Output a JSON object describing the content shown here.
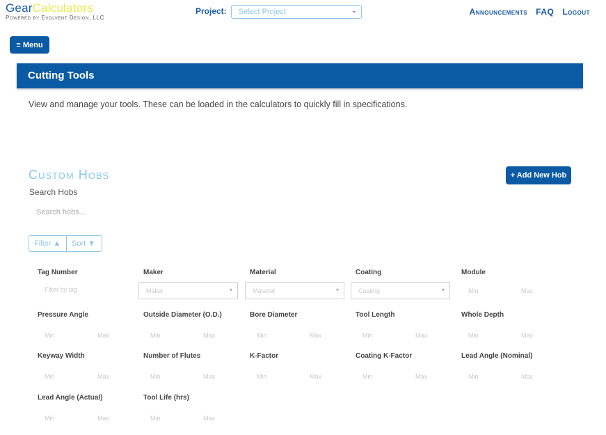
{
  "brand": {
    "part1": "Gear",
    "part2": "Calculators",
    "subtitle": "Powered by Evolvent Design, LLC"
  },
  "project": {
    "label": "Project:",
    "placeholder": "Select Project"
  },
  "nav": {
    "announcements": "Announcements",
    "faq": "FAQ",
    "logout": "Logout"
  },
  "menu_button": {
    "label": "Menu"
  },
  "banner": {
    "title": "Cutting Tools"
  },
  "intro": "View and manage your tools. These can be loaded in the calculators to quickly fill in specifications.",
  "hobs": {
    "title": "Custom Hobs",
    "add_button": "+ Add New Hob",
    "search_label": "Search Hobs",
    "search_placeholder": "Search hobs...",
    "filter_button": "Filter",
    "sort_button": "Sort"
  },
  "filters": {
    "tag_number": {
      "label": "Tag Number",
      "placeholder": "Filter by tag"
    },
    "maker": {
      "label": "Maker",
      "placeholder": "Maker"
    },
    "material": {
      "label": "Material",
      "placeholder": "Material"
    },
    "coating": {
      "label": "Coating",
      "placeholder": "Coating"
    },
    "module": {
      "label": "Module"
    },
    "pressure_angle": {
      "label": "Pressure Angle"
    },
    "outside_diameter": {
      "label": "Outside Diameter (O.D.)"
    },
    "bore_diameter": {
      "label": "Bore Diameter"
    },
    "tool_length": {
      "label": "Tool Length"
    },
    "whole_depth": {
      "label": "Whole Depth"
    },
    "keyway_width": {
      "label": "Keyway Width"
    },
    "number_of_flutes": {
      "label": "Number of Flutes"
    },
    "k_factor": {
      "label": "K-Factor"
    },
    "coating_k_factor": {
      "label": "Coating K-Factor"
    },
    "lead_angle_nominal": {
      "label": "Lead Angle (Nominal)"
    },
    "lead_angle_actual": {
      "label": "Lead Angle (Actual)"
    },
    "tool_life": {
      "label": "Tool Life (hrs)"
    },
    "min": "Min",
    "max": "Max"
  },
  "icons": {
    "menu": "hamburger-icon",
    "chevron": "chevron-down-icon",
    "filter": "triangle-up-icon",
    "sort": "triangle-down-icon"
  }
}
